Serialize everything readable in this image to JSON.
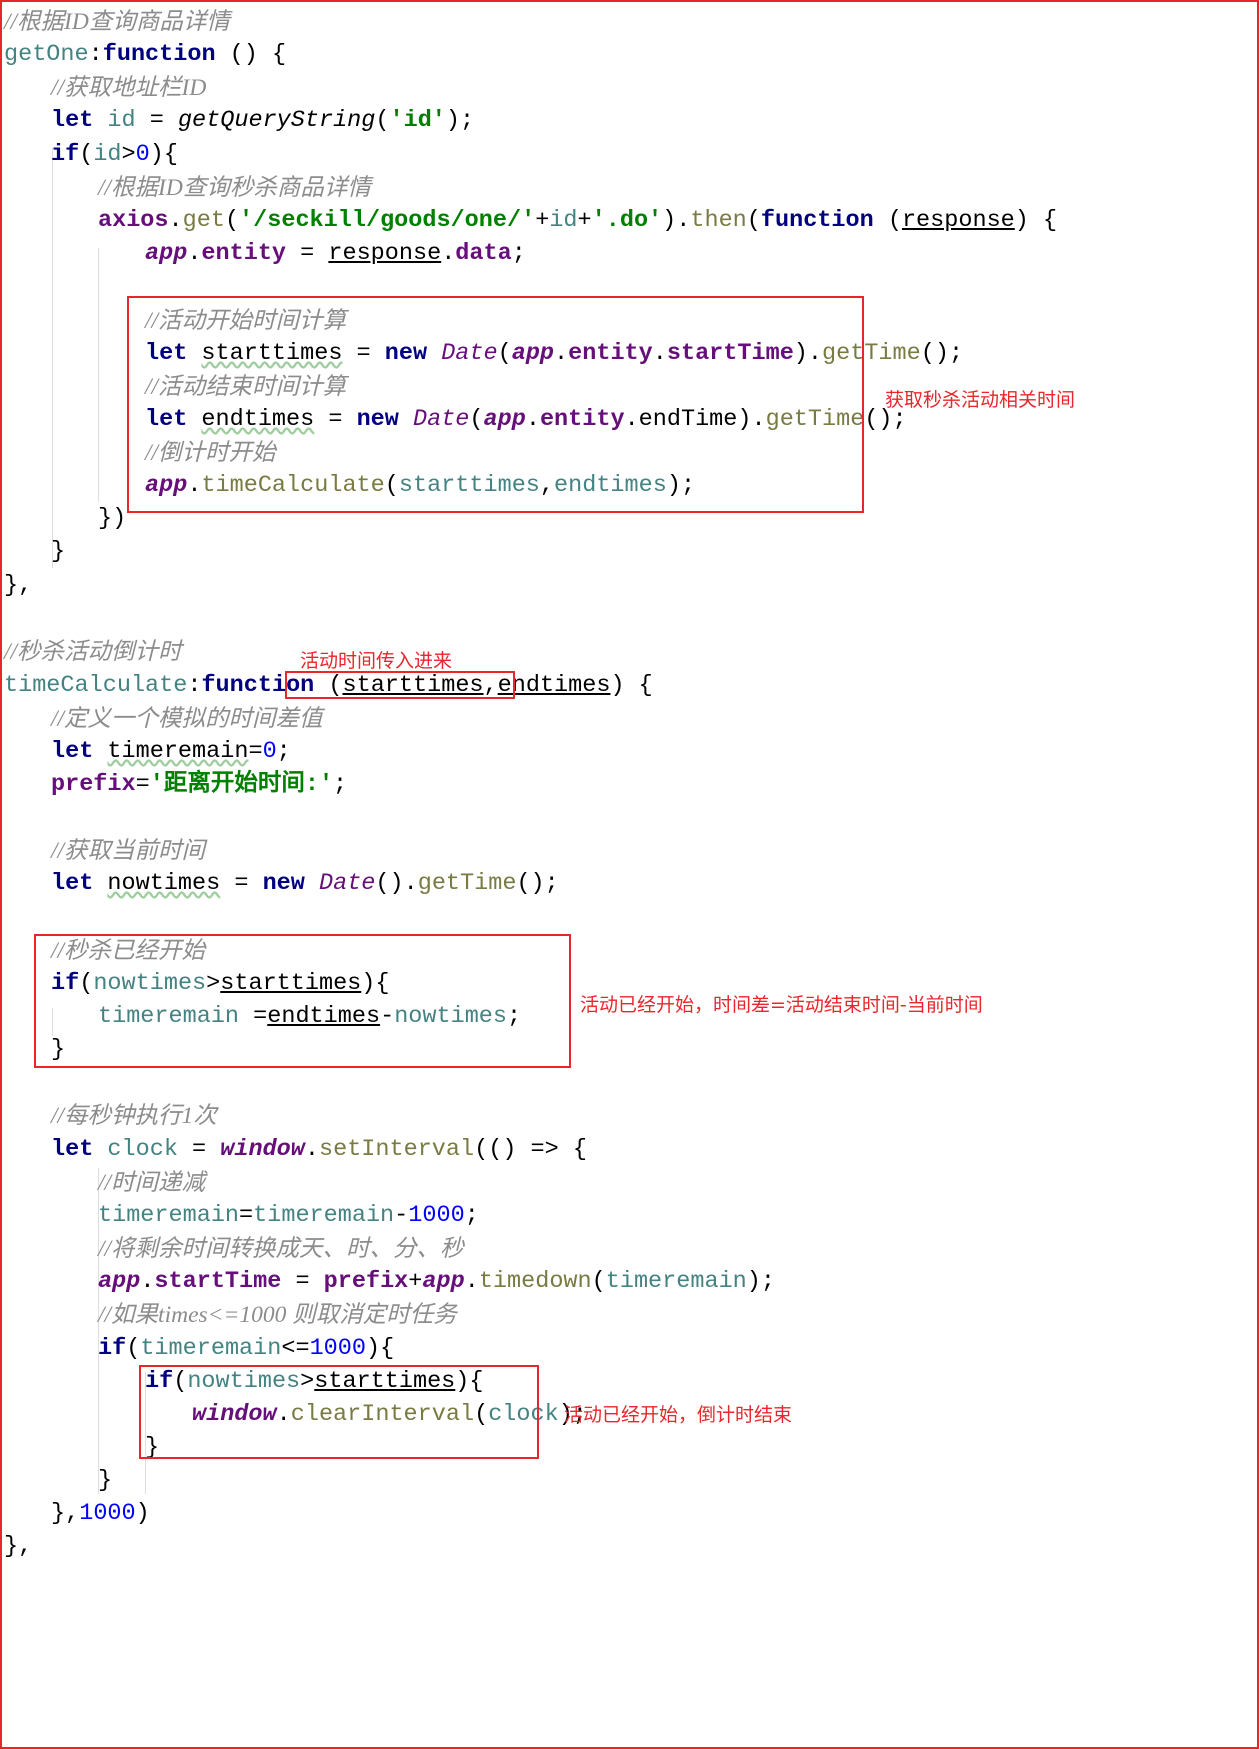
{
  "lines": [
    {
      "name": "comment-get-goods-by-id",
      "t": [
        [
          "cmt",
          "//根据ID查询商品详情"
        ]
      ]
    },
    {
      "name": "getone-declaration",
      "t": [
        [
          "var",
          "getOne"
        ],
        [
          "plain",
          ":"
        ],
        [
          "kw",
          "function"
        ],
        [
          "plain",
          " () {"
        ]
      ]
    },
    {
      "name": "comment-get-url-id",
      "t": [
        [
          "cmt",
          "//获取地址栏ID"
        ]
      ]
    },
    {
      "name": "let-id",
      "t": [
        [
          "kw",
          "let"
        ],
        [
          "plain",
          " "
        ],
        [
          "var",
          "id"
        ],
        [
          "plain",
          " = "
        ],
        [
          "fn",
          "getQueryString"
        ],
        [
          "plain",
          "("
        ],
        [
          "str",
          "'id'"
        ],
        [
          "plain",
          ");"
        ]
      ]
    },
    {
      "name": "if-id",
      "t": [
        [
          "kw",
          "if"
        ],
        [
          "plain",
          "("
        ],
        [
          "var",
          "id"
        ],
        [
          "plain",
          ">"
        ],
        [
          "num",
          "0"
        ],
        [
          "plain",
          "){"
        ]
      ]
    },
    {
      "name": "comment-query-seckill-goods",
      "t": [
        [
          "cmt",
          "//根据ID查询秒杀商品详情"
        ]
      ]
    },
    {
      "name": "axios-get-call",
      "t": [
        [
          "prop",
          "axios"
        ],
        [
          "plain",
          "."
        ],
        [
          "meth",
          "get"
        ],
        [
          "plain",
          "("
        ],
        [
          "str",
          "'/seckill/goods/one/'"
        ],
        [
          "plain",
          "+"
        ],
        [
          "var",
          "id"
        ],
        [
          "plain",
          "+"
        ],
        [
          "str",
          "'.do'"
        ],
        [
          "plain",
          ")."
        ],
        [
          "meth",
          "then"
        ],
        [
          "plain",
          "("
        ],
        [
          "kw",
          "function"
        ],
        [
          "plain",
          " ("
        ],
        [
          "ul",
          "response"
        ],
        [
          "plain",
          ") {"
        ]
      ]
    },
    {
      "name": "assign-entity",
      "t": [
        [
          "glob",
          "app"
        ],
        [
          "plain",
          "."
        ],
        [
          "prop",
          "entity"
        ],
        [
          "plain",
          " = "
        ],
        [
          "ul",
          "response"
        ],
        [
          "plain",
          "."
        ],
        [
          "prop",
          "data"
        ],
        [
          "plain",
          ";"
        ]
      ]
    },
    {
      "name": "blank-line",
      "t": []
    },
    {
      "name": "comment-start-time-calc",
      "t": [
        [
          "cmt",
          "//活动开始时间计算"
        ]
      ]
    },
    {
      "name": "let-starttimes",
      "t": [
        [
          "kw",
          "let"
        ],
        [
          "plain",
          " "
        ],
        [
          "wavy",
          "starttimes"
        ],
        [
          "plain",
          " = "
        ],
        [
          "kw",
          "new"
        ],
        [
          "plain",
          " "
        ],
        [
          "cls",
          "Date"
        ],
        [
          "plain",
          "("
        ],
        [
          "glob",
          "app"
        ],
        [
          "plain",
          "."
        ],
        [
          "prop",
          "entity"
        ],
        [
          "plain",
          "."
        ],
        [
          "prop",
          "startTime"
        ],
        [
          "plain",
          ")."
        ],
        [
          "meth",
          "getTime"
        ],
        [
          "plain",
          "();"
        ]
      ]
    },
    {
      "name": "comment-end-time-calc",
      "t": [
        [
          "cmt",
          "//活动结束时间计算"
        ]
      ]
    },
    {
      "name": "let-endtimes",
      "t": [
        [
          "kw",
          "let"
        ],
        [
          "plain",
          " "
        ],
        [
          "wavy",
          "endtimes"
        ],
        [
          "plain",
          " = "
        ],
        [
          "kw",
          "new"
        ],
        [
          "plain",
          " "
        ],
        [
          "cls",
          "Date"
        ],
        [
          "plain",
          "("
        ],
        [
          "glob",
          "app"
        ],
        [
          "plain",
          "."
        ],
        [
          "prop",
          "entity"
        ],
        [
          "plain",
          ".endTime)."
        ],
        [
          "meth",
          "getTime"
        ],
        [
          "plain",
          "();"
        ]
      ]
    },
    {
      "name": "comment-countdown-start",
      "t": [
        [
          "cmt",
          "//倒计时开始"
        ]
      ]
    },
    {
      "name": "call-timecalculate",
      "t": [
        [
          "glob",
          "app"
        ],
        [
          "plain",
          "."
        ],
        [
          "meth",
          "timeCalculate"
        ],
        [
          "plain",
          "("
        ],
        [
          "var",
          "starttimes"
        ],
        [
          "plain",
          ","
        ],
        [
          "var",
          "endtimes"
        ],
        [
          "plain",
          ");"
        ]
      ]
    },
    {
      "name": "close-then",
      "t": [
        [
          "plain",
          "})"
        ]
      ]
    },
    {
      "name": "close-if",
      "t": [
        [
          "plain",
          "}"
        ]
      ]
    },
    {
      "name": "close-getone",
      "t": [
        [
          "plain",
          "},"
        ]
      ]
    },
    {
      "name": "blank-line",
      "t": []
    },
    {
      "name": "comment-seckill-countdown",
      "t": [
        [
          "cmt",
          "//秒杀活动倒计时"
        ]
      ]
    },
    {
      "name": "timecalculate-declaration",
      "t": [
        [
          "var",
          "timeCalculate"
        ],
        [
          "plain",
          ":"
        ],
        [
          "kw",
          "function"
        ],
        [
          "plain",
          " ("
        ],
        [
          "ul",
          "starttimes"
        ],
        [
          "plain",
          ","
        ],
        [
          "ul",
          "endtimes"
        ],
        [
          "plain",
          ") {"
        ]
      ]
    },
    {
      "name": "comment-define-time-diff",
      "t": [
        [
          "cmt",
          "//定义一个模拟的时间差值"
        ]
      ]
    },
    {
      "name": "let-timeremain",
      "t": [
        [
          "kw",
          "let"
        ],
        [
          "plain",
          " "
        ],
        [
          "wavy",
          "timeremain"
        ],
        [
          "plain",
          "="
        ],
        [
          "num",
          "0"
        ],
        [
          "plain",
          ";"
        ]
      ]
    },
    {
      "name": "assign-prefix",
      "t": [
        [
          "prop",
          "prefix"
        ],
        [
          "plain",
          "="
        ],
        [
          "str",
          "'距离开始时间:'"
        ],
        [
          "plain",
          ";"
        ]
      ]
    },
    {
      "name": "blank-line",
      "t": []
    },
    {
      "name": "comment-get-current-time",
      "t": [
        [
          "cmt",
          "//获取当前时间"
        ]
      ]
    },
    {
      "name": "let-nowtimes",
      "t": [
        [
          "kw",
          "let"
        ],
        [
          "plain",
          " "
        ],
        [
          "wavy",
          "nowtimes"
        ],
        [
          "plain",
          " = "
        ],
        [
          "kw",
          "new"
        ],
        [
          "plain",
          " "
        ],
        [
          "cls",
          "Date"
        ],
        [
          "plain",
          "()."
        ],
        [
          "meth",
          "getTime"
        ],
        [
          "plain",
          "();"
        ]
      ]
    },
    {
      "name": "blank-line",
      "t": []
    },
    {
      "name": "comment-seckill-started",
      "t": [
        [
          "cmt",
          "//秒杀已经开始"
        ]
      ]
    },
    {
      "name": "if-nowtimes-gt-starttimes",
      "t": [
        [
          "kw",
          "if"
        ],
        [
          "plain",
          "("
        ],
        [
          "var",
          "nowtimes"
        ],
        [
          "plain",
          ">"
        ],
        [
          "ul",
          "starttimes"
        ],
        [
          "plain",
          "){"
        ]
      ]
    },
    {
      "name": "assign-timeremain-diff",
      "t": [
        [
          "var",
          "timeremain"
        ],
        [
          "plain",
          " ="
        ],
        [
          "ul",
          "endtimes"
        ],
        [
          "plain",
          "-"
        ],
        [
          "var",
          "nowtimes"
        ],
        [
          "plain",
          ";"
        ]
      ]
    },
    {
      "name": "close-if-started",
      "t": [
        [
          "plain",
          "}"
        ]
      ]
    },
    {
      "name": "blank-line",
      "t": []
    },
    {
      "name": "comment-every-second",
      "t": [
        [
          "cmt",
          "//每秒钟执行1次"
        ]
      ]
    },
    {
      "name": "let-clock",
      "t": [
        [
          "kw",
          "let"
        ],
        [
          "plain",
          " "
        ],
        [
          "var",
          "clock"
        ],
        [
          "plain",
          " = "
        ],
        [
          "glob",
          "window"
        ],
        [
          "plain",
          "."
        ],
        [
          "meth",
          "setInterval"
        ],
        [
          "plain",
          "(() => {"
        ]
      ]
    },
    {
      "name": "comment-time-decrement",
      "t": [
        [
          "cmt",
          "//时间递减"
        ]
      ]
    },
    {
      "name": "decrement-timeremain",
      "t": [
        [
          "var",
          "timeremain"
        ],
        [
          "plain",
          "="
        ],
        [
          "var",
          "timeremain"
        ],
        [
          "plain",
          "-"
        ],
        [
          "num",
          "1000"
        ],
        [
          "plain",
          ";"
        ]
      ]
    },
    {
      "name": "comment-convert-remaining",
      "t": [
        [
          "cmt",
          "//将剩余时间转换成天、时、分、秒"
        ]
      ]
    },
    {
      "name": "assign-app-starttime",
      "t": [
        [
          "glob",
          "app"
        ],
        [
          "plain",
          "."
        ],
        [
          "prop",
          "startTime"
        ],
        [
          "plain",
          " = "
        ],
        [
          "prop",
          "prefix"
        ],
        [
          "plain",
          "+"
        ],
        [
          "glob",
          "app"
        ],
        [
          "plain",
          "."
        ],
        [
          "meth",
          "timedown"
        ],
        [
          "plain",
          "("
        ],
        [
          "var",
          "timeremain"
        ],
        [
          "plain",
          ");"
        ]
      ]
    },
    {
      "name": "comment-cancel-timer",
      "t": [
        [
          "cmt",
          "//如果times<=1000 则取消定时任务"
        ]
      ]
    },
    {
      "name": "if-timeremain-le-1000",
      "t": [
        [
          "kw",
          "if"
        ],
        [
          "plain",
          "("
        ],
        [
          "var",
          "timeremain"
        ],
        [
          "plain",
          "<="
        ],
        [
          "num",
          "1000"
        ],
        [
          "plain",
          "){"
        ]
      ]
    },
    {
      "name": "if-nowtimes-gt-starttimes-inner",
      "t": [
        [
          "kw",
          "if"
        ],
        [
          "plain",
          "("
        ],
        [
          "var",
          "nowtimes"
        ],
        [
          "plain",
          ">"
        ],
        [
          "ul",
          "starttimes"
        ],
        [
          "plain",
          "){"
        ]
      ]
    },
    {
      "name": "clear-interval",
      "t": [
        [
          "glob",
          "window"
        ],
        [
          "plain",
          "."
        ],
        [
          "meth",
          "clearInterval"
        ],
        [
          "plain",
          "("
        ],
        [
          "var",
          "clock"
        ],
        [
          "plain",
          ");"
        ]
      ]
    },
    {
      "name": "close-inner-if",
      "t": [
        [
          "plain",
          "}"
        ]
      ]
    },
    {
      "name": "close-if-timeremain",
      "t": [
        [
          "plain",
          "}"
        ]
      ]
    },
    {
      "name": "close-setinterval",
      "t": [
        [
          "plain",
          "},"
        ],
        [
          "num",
          "1000"
        ],
        [
          "plain",
          ")"
        ]
      ]
    },
    {
      "name": "close-timecalculate",
      "t": [
        [
          "plain",
          "},"
        ]
      ]
    }
  ],
  "annotations": {
    "fetch_times": "获取秒杀活动相关时间",
    "params_passed": "活动时间传入进来",
    "started_diff": "活动已经开始，时间差=活动结束时间-当前时间",
    "countdown_end": "活动已经开始，倒计时结束"
  },
  "colors": {
    "highlight": "#e8262b",
    "keyword": "#000080",
    "string": "#008000",
    "number": "#0000ff",
    "comment": "#8c8c8c",
    "identifier": "#458383",
    "property": "#660e7a",
    "method": "#7a7a43"
  }
}
